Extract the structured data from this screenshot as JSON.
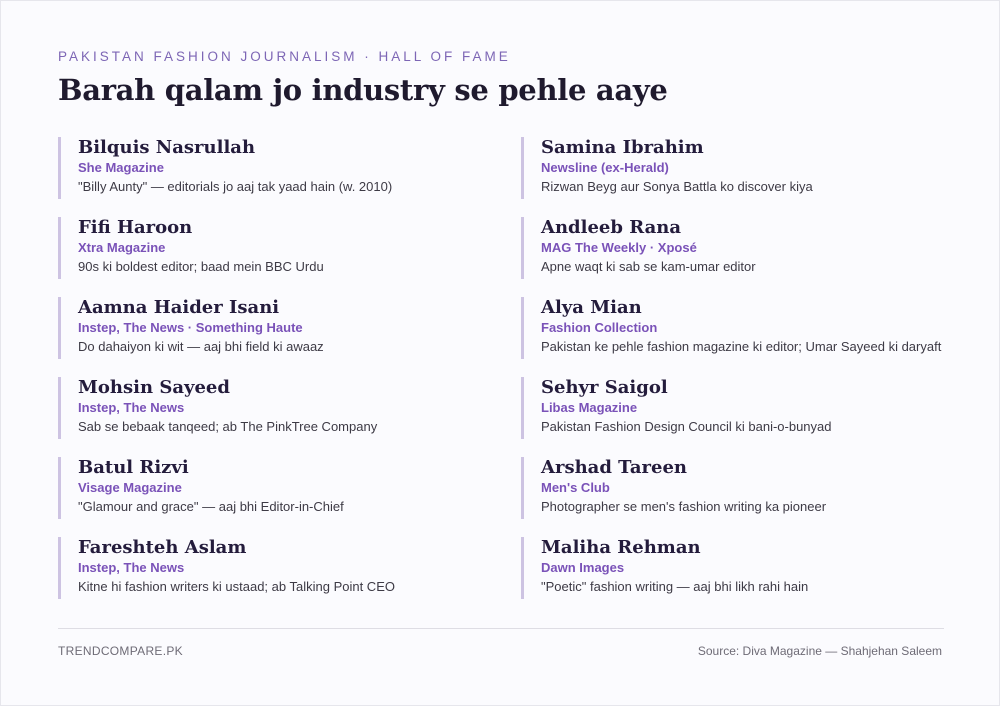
{
  "header": {
    "eyebrow": "PAKISTAN FASHION JOURNALISM · HALL OF FAME",
    "title": "Barah qalam jo industry se pehle aaye"
  },
  "left_column": [
    {
      "name": "Bilquis Nasrullah",
      "publication": "She Magazine",
      "note": "\"Billy Aunty\" — editorials jo aaj tak yaad hain (w. 2010)"
    },
    {
      "name": "Fifi Haroon",
      "publication": "Xtra Magazine",
      "note": "90s ki boldest editor; baad mein BBC Urdu"
    },
    {
      "name": "Aamna Haider Isani",
      "publication": "Instep, The News · Something Haute",
      "note": "Do dahaiyon ki wit — aaj bhi field ki awaaz"
    },
    {
      "name": "Mohsin Sayeed",
      "publication": "Instep, The News",
      "note": "Sab se bebaak tanqeed; ab The PinkTree Company"
    },
    {
      "name": "Batul Rizvi",
      "publication": "Visage Magazine",
      "note": "\"Glamour and grace\" — aaj bhi Editor-in-Chief"
    },
    {
      "name": "Fareshteh Aslam",
      "publication": "Instep, The News",
      "note": "Kitne hi fashion writers ki ustaad; ab Talking Point CEO"
    }
  ],
  "right_column": [
    {
      "name": "Samina Ibrahim",
      "publication": "Newsline (ex-Herald)",
      "note": "Rizwan Beyg aur Sonya Battla ko discover kiya"
    },
    {
      "name": "Andleeb Rana",
      "publication": "MAG The Weekly · Xposé",
      "note": "Apne waqt ki sab se kam-umar editor"
    },
    {
      "name": "Alya Mian",
      "publication": "Fashion Collection",
      "note": "Pakistan ke pehle fashion magazine ki editor; Umar Sayeed ki daryaft"
    },
    {
      "name": "Sehyr Saigol",
      "publication": "Libas Magazine",
      "note": "Pakistan Fashion Design Council ki bani-o-bunyad"
    },
    {
      "name": "Arshad Tareen",
      "publication": "Men's Club",
      "note": "Photographer se men's fashion writing ka pioneer"
    },
    {
      "name": "Maliha Rehman",
      "publication": "Dawn Images",
      "note": "\"Poetic\" fashion writing — aaj bhi likh rahi hain"
    }
  ],
  "footer": {
    "site": "TRENDCOMPARE.PK",
    "source": "Source: Diva Magazine — Shahjehan Saleem"
  },
  "colors": {
    "accent": "#7a52b8",
    "rule": "#cdc3e2",
    "name": "#241c3c",
    "background": "#fbfbfe"
  }
}
